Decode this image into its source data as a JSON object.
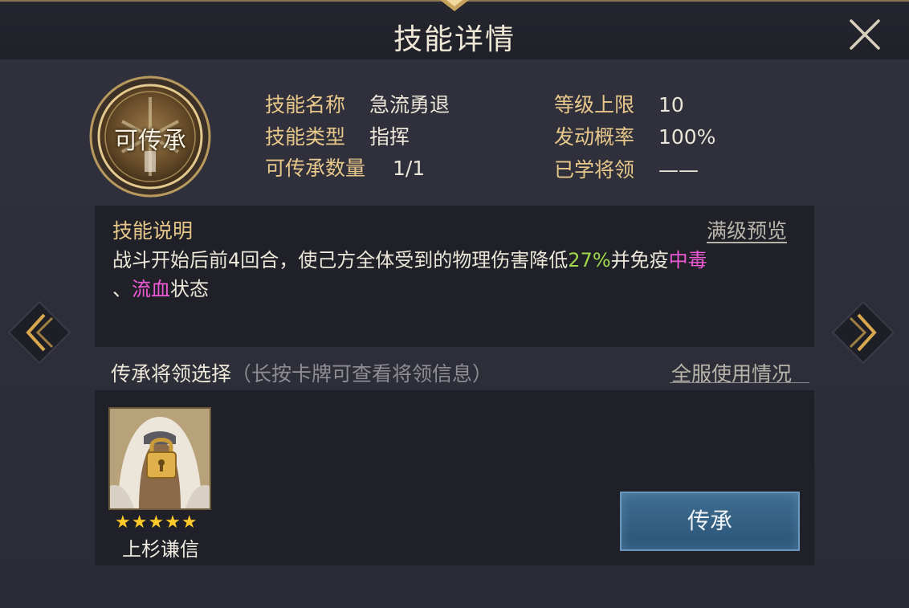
{
  "header": {
    "title": "技能详情"
  },
  "emblem": {
    "label": "可传承"
  },
  "info": {
    "name_label": "技能名称",
    "name_value": "急流勇退",
    "type_label": "技能类型",
    "type_value": "指挥",
    "count_label": "可传承数量",
    "count_value": "1/1",
    "level_label": "等级上限",
    "level_value": "10",
    "rate_label": "发动概率",
    "rate_value": "100%",
    "learned_label": "已学将领",
    "learned_value": "——"
  },
  "description": {
    "title": "技能说明",
    "full_preview": "满级预览",
    "text_1": "战斗开始后前4回合，使己方全体受到的物理伤害降低",
    "pct": "27%",
    "text_2": "并免疫",
    "status_1": "中毒",
    "sep": "、",
    "status_2": "流血",
    "text_3": "状态"
  },
  "selection": {
    "title": "传承将领选择",
    "hint": "（长按卡牌可查看将领信息）",
    "server_usage": "全服使用情况"
  },
  "general": {
    "name": "上杉谦信",
    "stars": "★★★★★",
    "star_count": 5,
    "locked": true
  },
  "actions": {
    "inherit": "传承"
  },
  "colors": {
    "gold": "#e8c88a",
    "green": "#9fd84a",
    "pink": "#f05ad6",
    "button": "#2b5578"
  }
}
